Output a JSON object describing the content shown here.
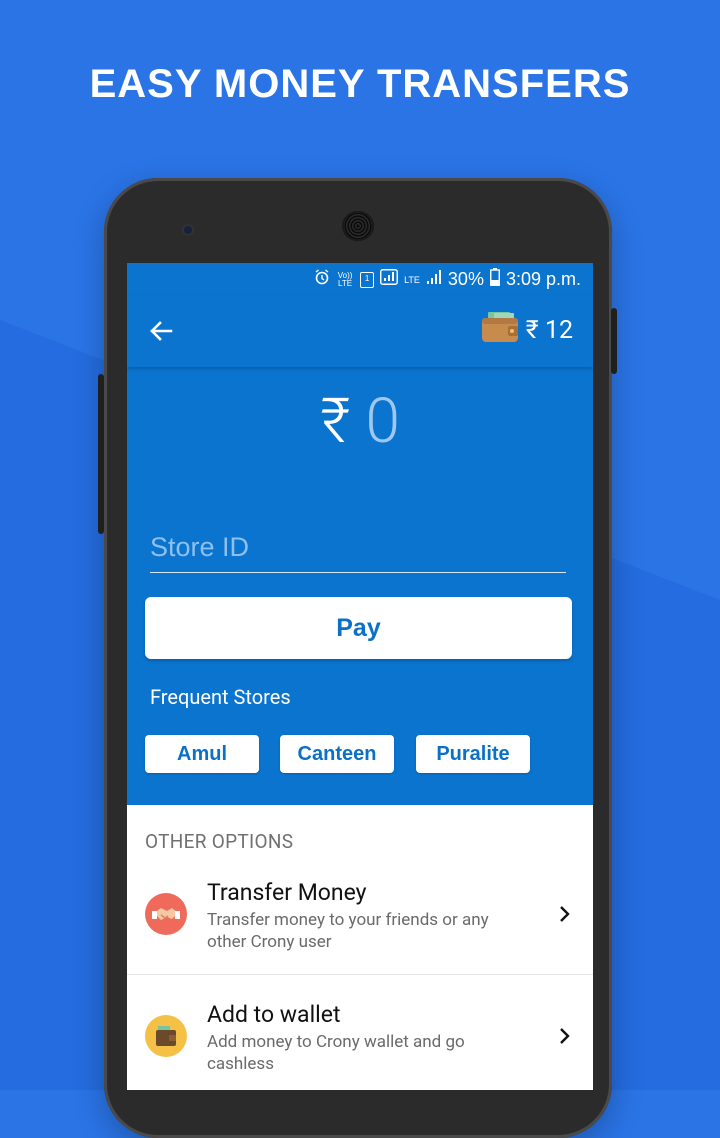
{
  "promo": {
    "title": "EASY MONEY TRANSFERS"
  },
  "status_bar": {
    "battery": "30%",
    "time": "3:09 p.m.",
    "lte": "LTE",
    "volte": "Vo)) LTE"
  },
  "app_bar": {
    "wallet_balance": "₹ 12"
  },
  "payment": {
    "currency_symbol": "₹",
    "amount": "0",
    "store_id_placeholder": "Store ID",
    "pay_label": "Pay",
    "frequent_label": "Frequent Stores",
    "frequent_stores": [
      "Amul",
      "Canteen",
      "Puralite"
    ]
  },
  "other_options": {
    "header": "OTHER OPTIONS",
    "items": [
      {
        "title": "Transfer Money",
        "description": "Transfer money to your friends or any other Crony user",
        "icon": "handshake-icon"
      },
      {
        "title": "Add to wallet",
        "description": "Add money to Crony wallet and go cashless",
        "icon": "wallet-icon"
      }
    ]
  },
  "colors": {
    "background": "#2a74e6",
    "app_blue": "#0b74cf",
    "accent_text": "#0a70c8"
  }
}
